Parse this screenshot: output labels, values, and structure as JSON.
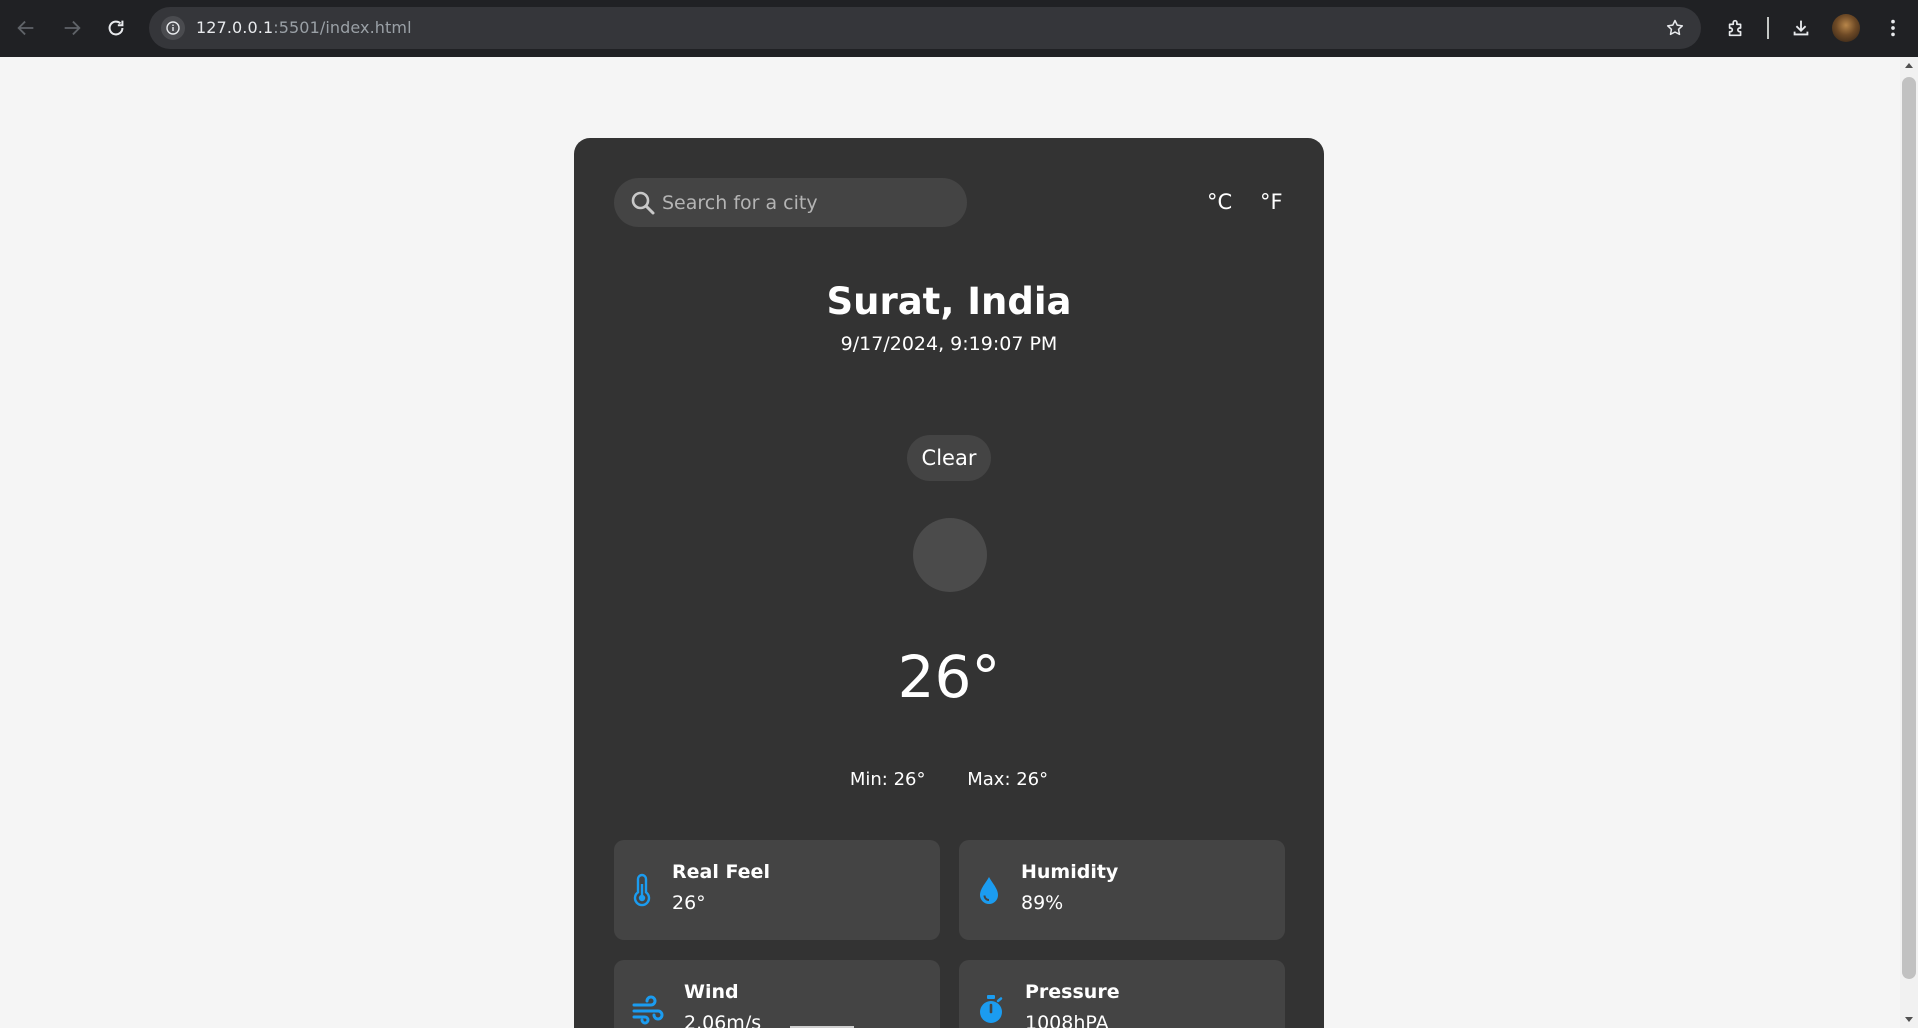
{
  "browser": {
    "url_host": "127.0.0.1",
    "url_rest": ":5501/index.html",
    "icons": [
      "back-icon",
      "forward-icon",
      "reload-icon",
      "site-info-icon",
      "bookmark-star-icon",
      "extensions-icon",
      "downloads-icon",
      "profile-avatar",
      "menu-dots-icon"
    ]
  },
  "search": {
    "placeholder": "Search for a city",
    "value": ""
  },
  "units": {
    "celsius": "°C",
    "fahrenheit": "°F"
  },
  "weather": {
    "city": "Surat, India",
    "datetime": "9/17/2024, 9:19:07 PM",
    "condition": "Clear",
    "temperature": "26°",
    "min": "Min: 26°",
    "max": "Max: 26°"
  },
  "details": {
    "real_feel": {
      "label": "Real Feel",
      "value": "26°",
      "icon": "thermometer-icon"
    },
    "humidity": {
      "label": "Humidity",
      "value": "89%",
      "icon": "droplet-icon"
    },
    "wind": {
      "label": "Wind",
      "value": "2.06m/s",
      "icon": "wind-icon"
    },
    "pressure": {
      "label": "Pressure",
      "value": "1008hPA",
      "icon": "stopwatch-icon"
    }
  },
  "colors": {
    "page_bg": "#f5f5f5",
    "card_bg": "#333333",
    "tile_bg": "#444444",
    "accent_icon": "#1b9cf0",
    "text": "#ffffff"
  }
}
